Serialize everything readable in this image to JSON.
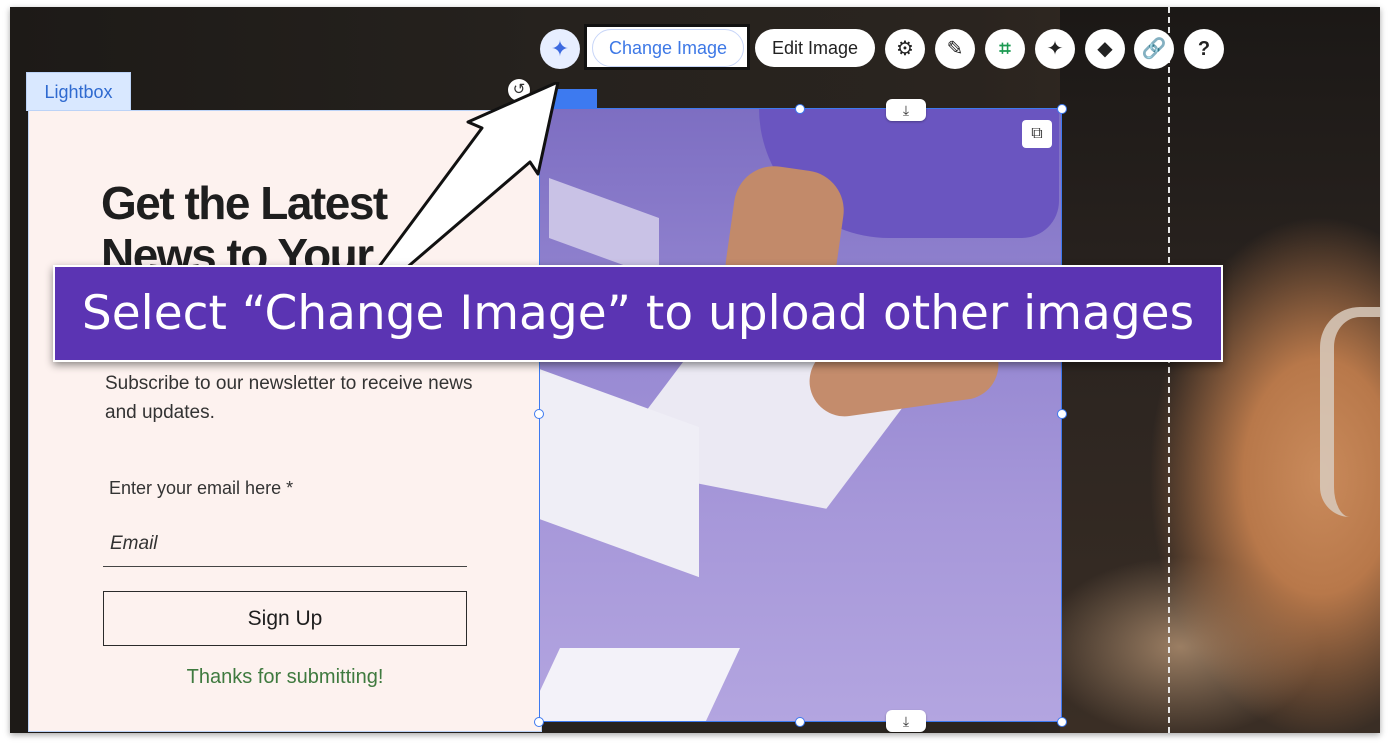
{
  "lightbox": {
    "tab_label": "Lightbox",
    "heading": "Get the Latest News to Your",
    "subtext": "Subscribe to our newsletter to receive news and updates.",
    "email_label": "Enter your email here *",
    "email_placeholder": "Email",
    "signup_label": "Sign Up",
    "thanks_text": "Thanks for submitting!"
  },
  "toolbar": {
    "ai_icon": "sparkle-icon",
    "change_image_label": "Change Image",
    "edit_image_label": "Edit Image",
    "tools": [
      {
        "name": "settings",
        "icon": "⚙"
      },
      {
        "name": "design",
        "icon": "✎"
      },
      {
        "name": "crop",
        "icon": "⌗"
      },
      {
        "name": "magic",
        "icon": "✦"
      },
      {
        "name": "animation",
        "icon": "◆"
      },
      {
        "name": "link",
        "icon": "🔗"
      },
      {
        "name": "help",
        "icon": "?"
      }
    ]
  },
  "banner": {
    "text": "Select “Change Image” to upload other images"
  },
  "colors": {
    "banner_bg": "#5b34b3",
    "selection": "#3d7af0",
    "lightbox_bg": "#fdf2ef",
    "thanks_green": "#3f7a3f"
  }
}
